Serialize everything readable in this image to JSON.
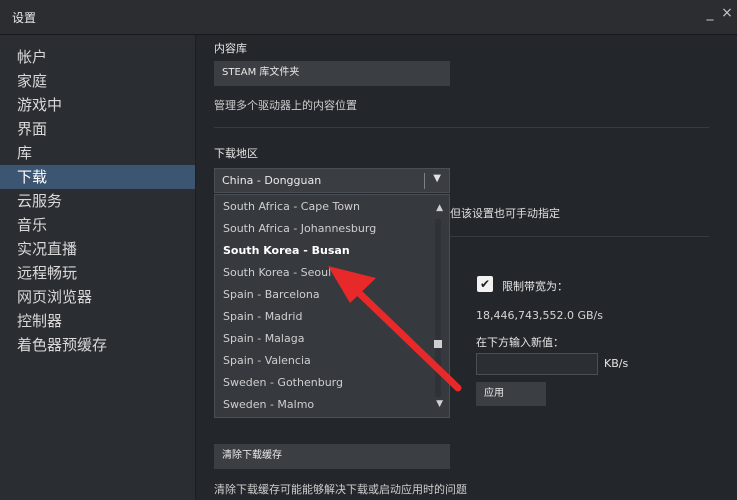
{
  "window": {
    "title": "设置",
    "minimize": "_",
    "close": "×"
  },
  "sidebar": {
    "items": [
      {
        "label": "帐户"
      },
      {
        "label": "家庭"
      },
      {
        "label": "游戏中"
      },
      {
        "label": "界面"
      },
      {
        "label": "库"
      },
      {
        "label": "下载",
        "active": true
      },
      {
        "label": "云服务"
      },
      {
        "label": "音乐"
      },
      {
        "label": "实况直播"
      },
      {
        "label": "远程畅玩"
      },
      {
        "label": "网页浏览器"
      },
      {
        "label": "控制器"
      },
      {
        "label": "着色器预缓存"
      }
    ]
  },
  "content": {
    "library": {
      "section_title": "内容库",
      "button_label": "STEAM 库文件夹",
      "description": "管理多个驱动器上的内容位置"
    },
    "download_region": {
      "section_title": "下载地区",
      "selected": "China - Dongguan",
      "partial_hint": "但该设置也可手动指定",
      "options": [
        "South Africa - Cape Town",
        "South Africa - Johannesburg",
        "South Korea - Busan",
        "South Korea - Seoul",
        "Spain - Barcelona",
        "Spain - Madrid",
        "Spain - Malaga",
        "Spain - Valencia",
        "Sweden - Gothenburg",
        "Sweden - Malmo"
      ],
      "hover_option_index": 2
    },
    "bandwidth": {
      "limit_label": "限制带宽为：",
      "limit_checked": true,
      "current_value": "18,446,743,552.0 GB/s",
      "new_value_label": "在下方输入新值：",
      "input_value": "",
      "unit": "KB/s",
      "apply_label": "应用"
    },
    "cache": {
      "button_label": "清除下载缓存",
      "description": "清除下载缓存可能能够解决下载或启动应用时的问题"
    }
  },
  "colors": {
    "accent": "#3c5570",
    "annotation_arrow": "#e8292a"
  },
  "icons": {
    "checkbox": "checkmark-icon",
    "dropdown": "chevron-down-icon",
    "annotation": "red-arrow-annotation"
  }
}
